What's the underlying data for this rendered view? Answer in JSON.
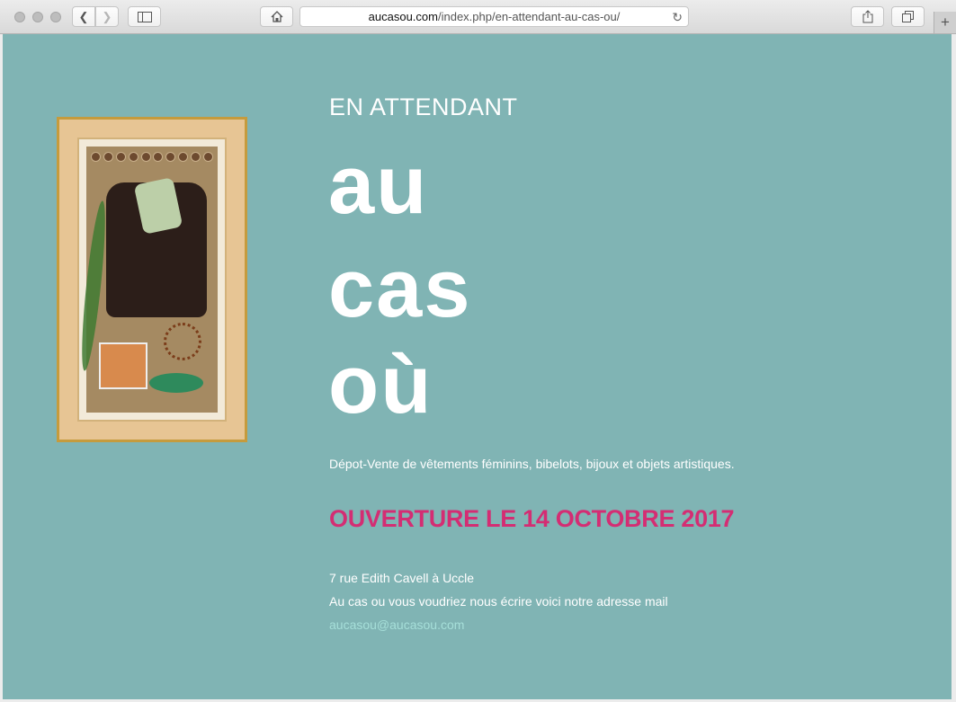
{
  "browser": {
    "url_host": "aucasou.com",
    "url_path": "/index.php/en-attendant-au-cas-ou/"
  },
  "site": {
    "kicker": "EN ATTENDANT",
    "logo_line1": "au",
    "logo_line2": "cas",
    "logo_line3": "où",
    "description": "Dépot-Vente de vêtements féminins, bibelots, bijoux et objets artistiques.",
    "opening": "OUVERTURE LE 14 OCTOBRE 2017",
    "address": "7 rue Edith Cavell à Uccle",
    "mail_note": "Au cas ou vous voudriez nous écrire voici notre adresse mail",
    "email": "aucasou@aucasou.com"
  },
  "colors": {
    "background": "#80b4b4",
    "accent": "#d42d73",
    "link": "#a6dfd9"
  }
}
